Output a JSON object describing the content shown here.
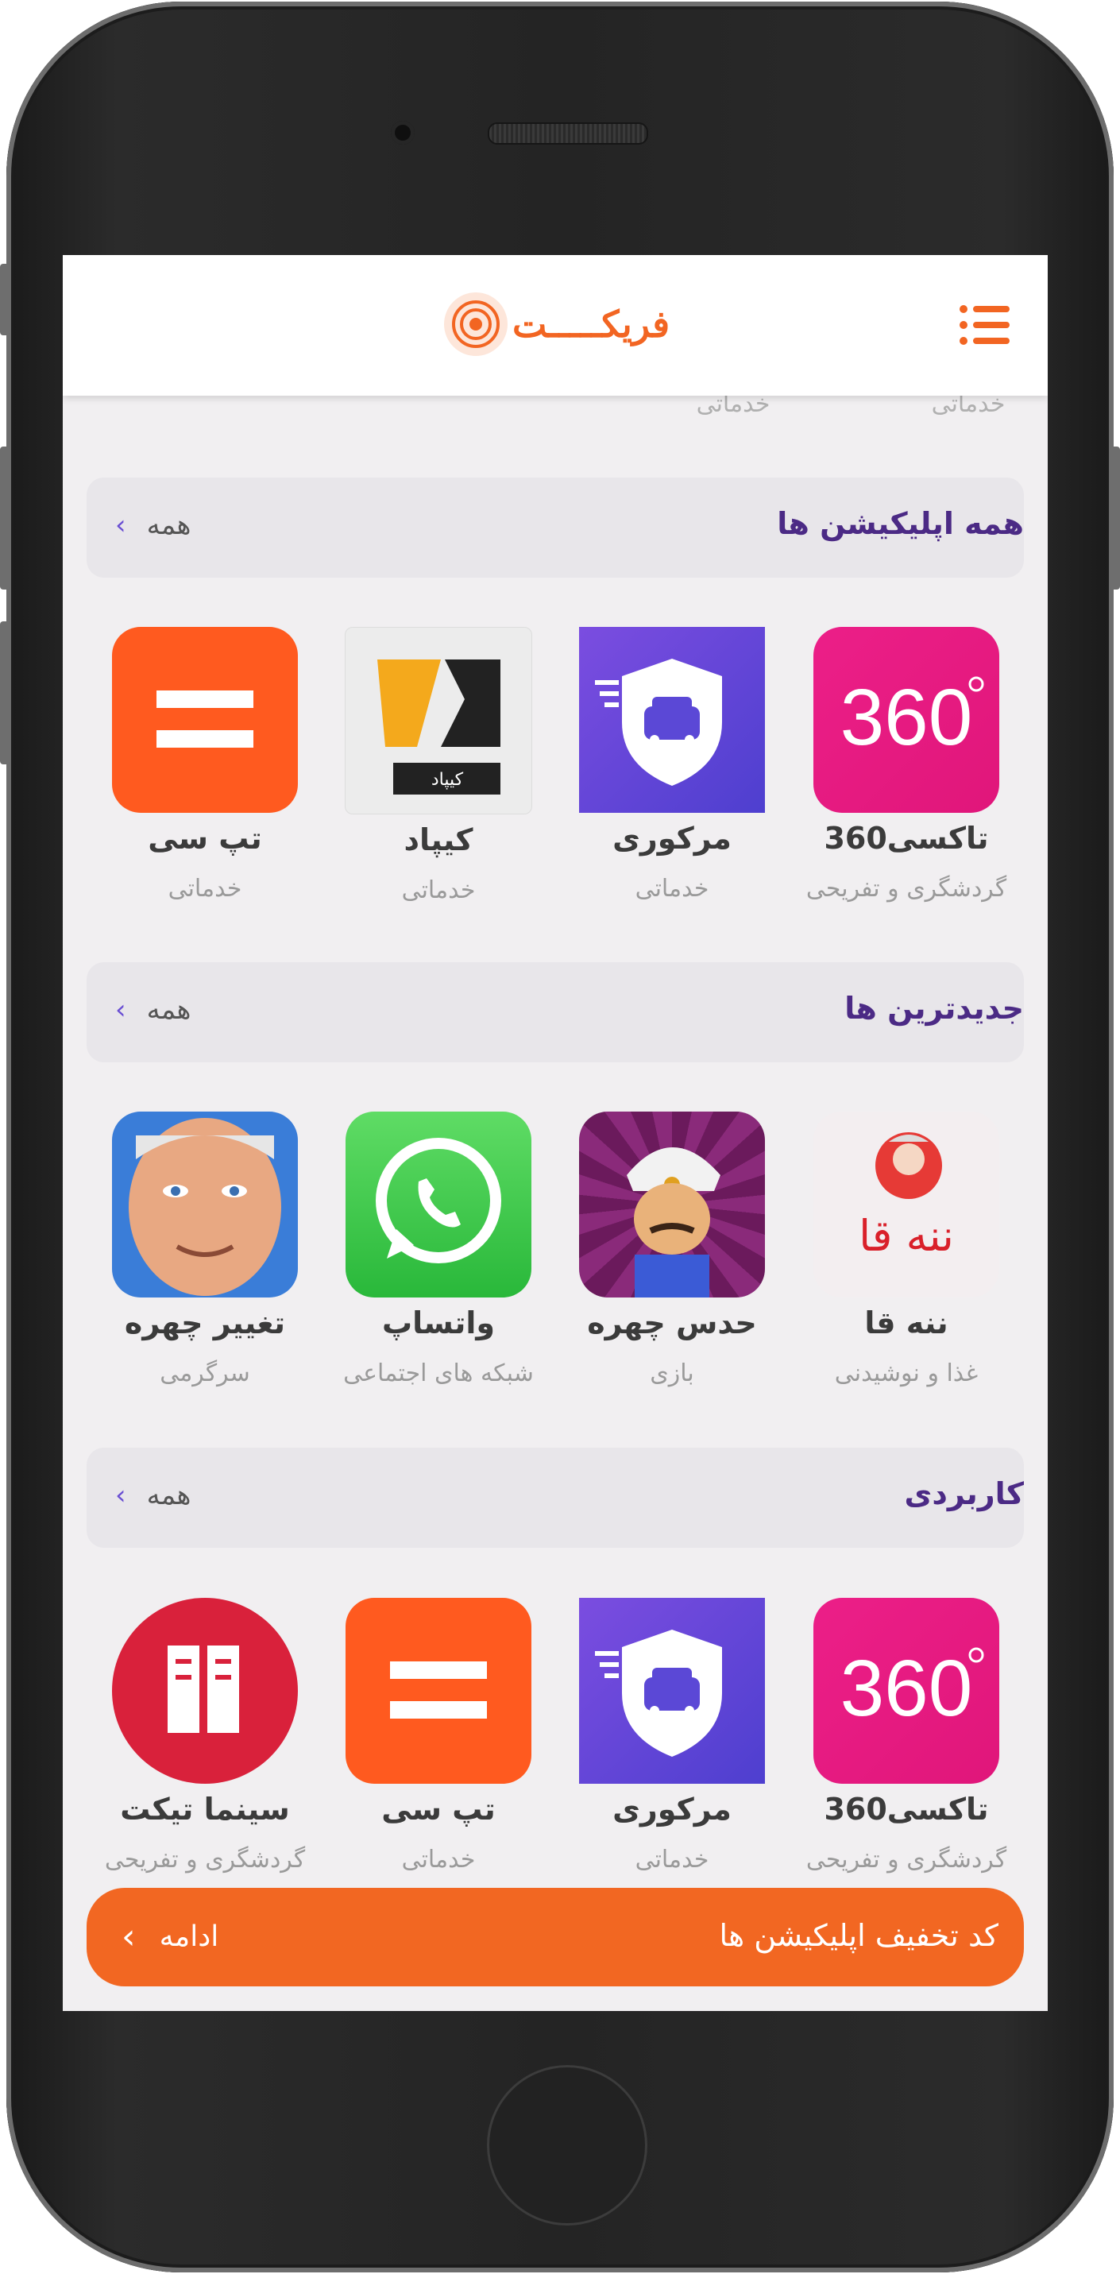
{
  "header": {
    "logo_text": "فریکـــــت",
    "menu_icon": "hamburger-menu-icon"
  },
  "faded_row": {
    "cat_left": "خدماتی",
    "cat_right": "خدماتی"
  },
  "sections": [
    {
      "title": "همه اپلیکیشن ها",
      "see_all": "همه",
      "apps": [
        {
          "name": "تاکسی360",
          "category": "گردشگری و تفریحی",
          "icon": "taxi360-icon"
        },
        {
          "name": "مرکوری",
          "category": "خدماتی",
          "icon": "mercury-car-shield-icon"
        },
        {
          "name": "کیپاد",
          "category": "خدماتی",
          "icon": "kipod-icon"
        },
        {
          "name": "تپ سی",
          "category": "خدماتی",
          "icon": "tapsi-icon"
        }
      ]
    },
    {
      "title": "جدیدترین ها",
      "see_all": "همه",
      "apps": [
        {
          "name": "ننه قا",
          "category": "غذا و نوشیدنی",
          "icon": "naneh-gha-icon"
        },
        {
          "name": "حدس چهره",
          "category": "بازی",
          "icon": "akinator-genie-icon"
        },
        {
          "name": "واتساپ",
          "category": "شبکه های اجتماعی",
          "icon": "whatsapp-icon"
        },
        {
          "name": "تغییر چهره",
          "category": "سرگرمی",
          "icon": "old-face-icon"
        }
      ]
    },
    {
      "title": "کاربردی",
      "see_all": "همه",
      "apps": [
        {
          "name": "تاکسی360",
          "category": "گردشگری و تفریحی",
          "icon": "taxi360-icon"
        },
        {
          "name": "مرکوری",
          "category": "خدماتی",
          "icon": "mercury-car-shield-icon"
        },
        {
          "name": "تپ سی",
          "category": "خدماتی",
          "icon": "tapsi-icon"
        },
        {
          "name": "سینما تیکت",
          "category": "گردشگری و تفریحی",
          "icon": "cinema-ticket-icon"
        }
      ]
    }
  ],
  "bottom_bar": {
    "label": "کد تخفیف اپلیکیشن ها",
    "continue": "ادامه"
  },
  "colors": {
    "accent": "#f26722",
    "title": "#4b2a85",
    "chevron": "#6a4fd3",
    "taxi_pink": "#e6197f",
    "mercury_purple": "#6a45d8",
    "tapsi_orange": "#ff5a1f",
    "whatsapp_green": "#3ecb47",
    "cinema_red": "#d9213b"
  }
}
